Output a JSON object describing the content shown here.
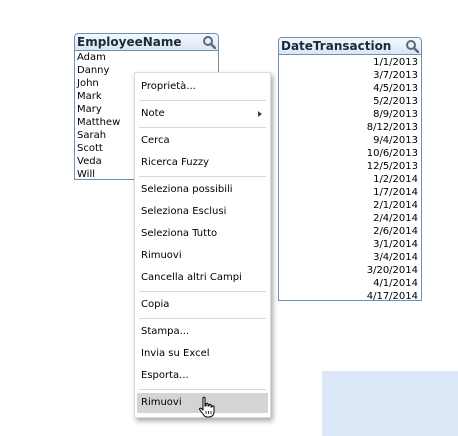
{
  "listbox_employee": {
    "title": "EmployeeName",
    "search_icon": "search-icon",
    "items": [
      "Adam",
      "Danny",
      "John",
      "Mark",
      "Mary",
      "Matthew",
      "Sarah",
      "Scott",
      "Veda",
      "Will"
    ]
  },
  "listbox_date": {
    "title": "DateTransaction",
    "search_icon": "search-icon",
    "items": [
      "1/1/2013",
      "3/7/2013",
      "4/5/2013",
      "5/2/2013",
      "8/9/2013",
      "8/12/2013",
      "9/4/2013",
      "10/6/2013",
      "12/5/2013",
      "1/2/2014",
      "1/7/2014",
      "2/1/2014",
      "2/4/2014",
      "2/6/2014",
      "3/1/2014",
      "3/4/2014",
      "3/20/2014",
      "4/1/2014",
      "4/17/2014"
    ]
  },
  "context_menu": {
    "items": [
      {
        "label": "Proprietà..."
      },
      {
        "label": "Note",
        "submenu_icon": "chevron-right-icon"
      },
      {
        "label": "Cerca"
      },
      {
        "label": "Ricerca Fuzzy"
      },
      {
        "label": "Seleziona possibili"
      },
      {
        "label": "Seleziona Esclusi"
      },
      {
        "label": "Seleziona Tutto"
      },
      {
        "label": "Rimuovi"
      },
      {
        "label": "Cancella altri Campi"
      },
      {
        "label": "Copia"
      },
      {
        "label": "Stampa..."
      },
      {
        "label": "Invia su Excel"
      },
      {
        "label": "Esporta..."
      },
      {
        "label": "Rimuovi"
      }
    ],
    "hovered_item": "Rimuovi"
  },
  "colors": {
    "listbox_border": "#6f8fb5",
    "caption_gradient_top": "#f4f8fd",
    "caption_gradient_bottom": "#dbe6f3",
    "menu_hover": "#d4d4d4",
    "panel_background": "#dce8f7"
  },
  "cursor_icon": "hand-pointer-icon"
}
